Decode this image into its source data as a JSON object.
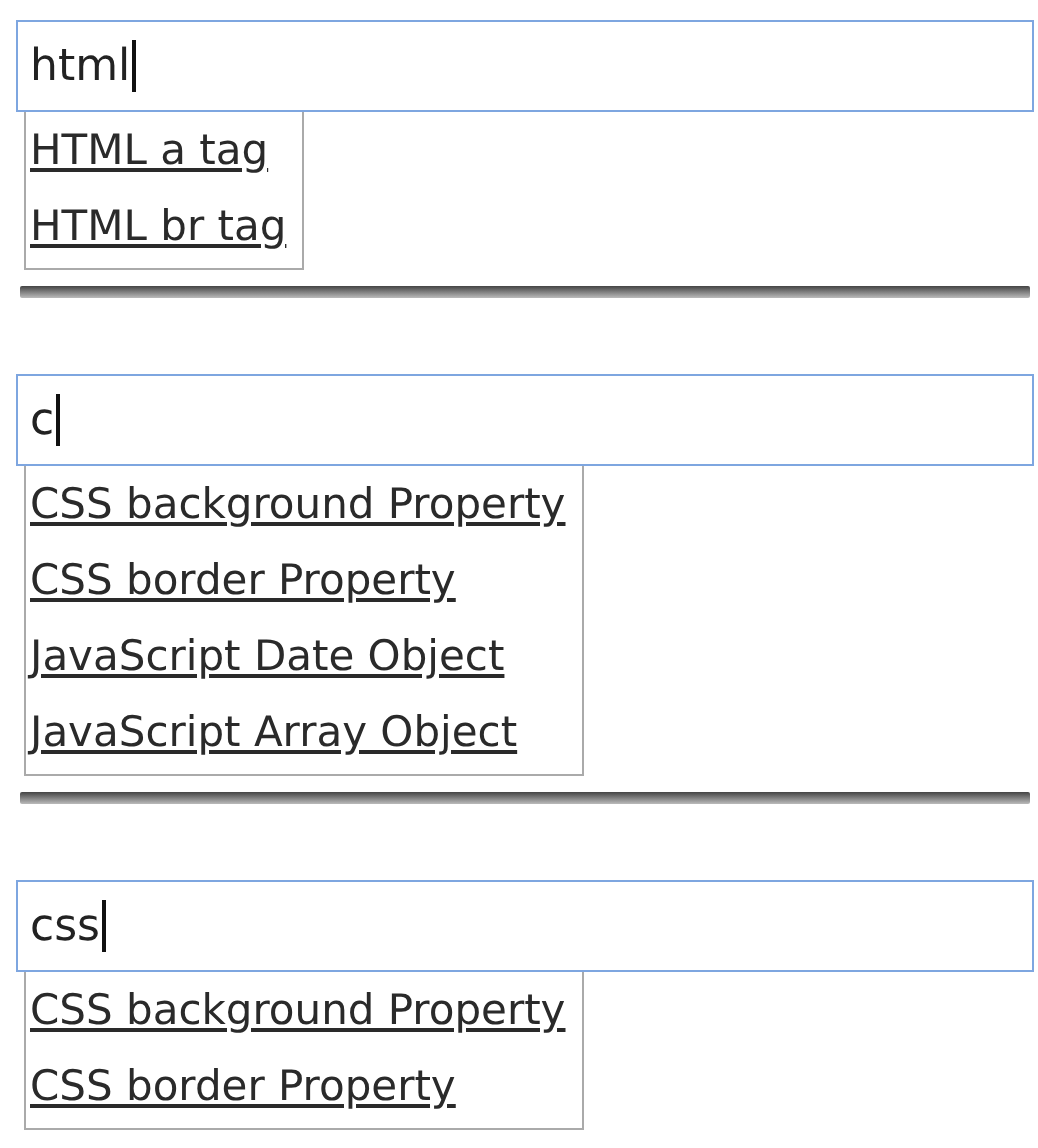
{
  "searches": [
    {
      "value": "html",
      "suggestions": [
        "HTML a tag",
        "HTML br tag"
      ]
    },
    {
      "value": "c",
      "suggestions": [
        "CSS background Property",
        "CSS border Property",
        "JavaScript Date Object",
        "JavaScript Array Object"
      ]
    },
    {
      "value": "css",
      "suggestions": [
        "CSS background Property",
        "CSS border Property"
      ]
    }
  ]
}
